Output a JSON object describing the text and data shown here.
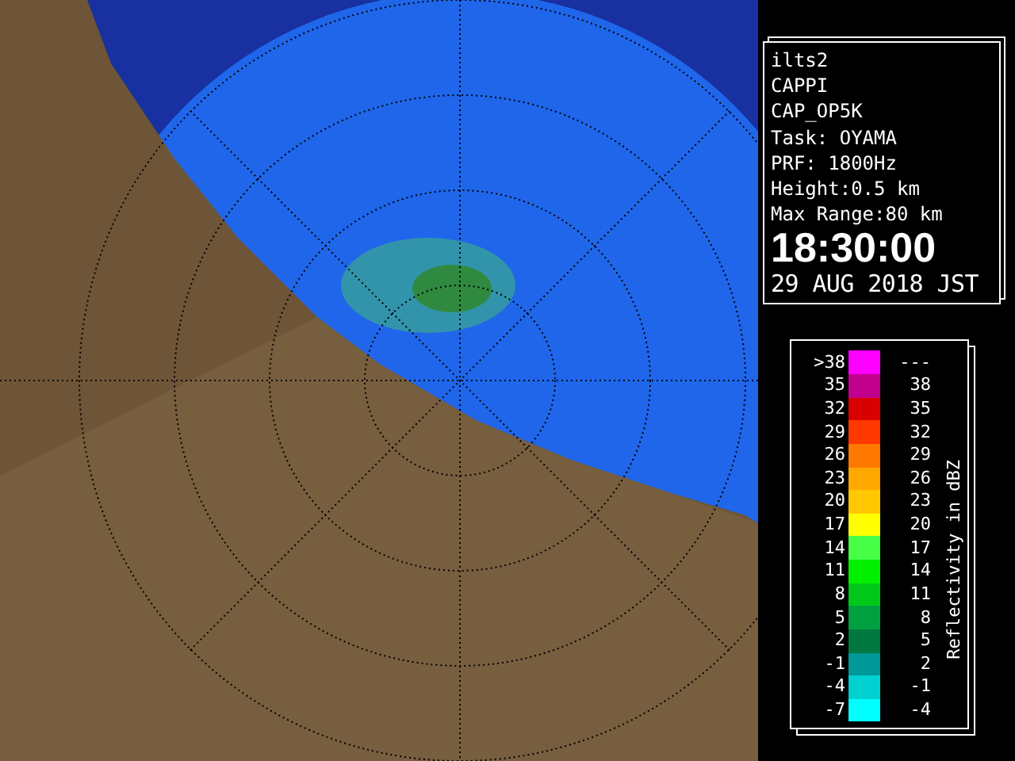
{
  "info": {
    "lines": [
      "ilts2",
      "CAPPI",
      "CAP_OP5K",
      "Task: OYAMA",
      "PRF: 1800Hz",
      "Height:0.5 km",
      "Max Range:80 km"
    ],
    "time": "18:30:00",
    "date": "29 AUG 2018 JST"
  },
  "legend": {
    "title": "Reflectivity in dBZ",
    "rows": [
      {
        "low": ">38",
        "high": "---",
        "color": "#ff00ff"
      },
      {
        "low": "35",
        "high": "38",
        "color": "#c0008c"
      },
      {
        "low": "32",
        "high": "35",
        "color": "#d80000"
      },
      {
        "low": "29",
        "high": "32",
        "color": "#ff3800"
      },
      {
        "low": "26",
        "high": "29",
        "color": "#ff7800"
      },
      {
        "low": "23",
        "high": "26",
        "color": "#ffa800"
      },
      {
        "low": "20",
        "high": "23",
        "color": "#ffc800"
      },
      {
        "low": "17",
        "high": "20",
        "color": "#ffff00"
      },
      {
        "low": "14",
        "high": "17",
        "color": "#48ff48"
      },
      {
        "low": "11",
        "high": "14",
        "color": "#00f000"
      },
      {
        "low": "8",
        "high": "11",
        "color": "#00c818"
      },
      {
        "low": "5",
        "high": "8",
        "color": "#00a040"
      },
      {
        "low": "2",
        "high": "5",
        "color": "#007840"
      },
      {
        "low": "-1",
        "high": "2",
        "color": "#009898"
      },
      {
        "low": "-4",
        "high": "-1",
        "color": "#00d0d0"
      },
      {
        "low": "-7",
        "high": "-4",
        "color": "#00ffff"
      }
    ]
  }
}
